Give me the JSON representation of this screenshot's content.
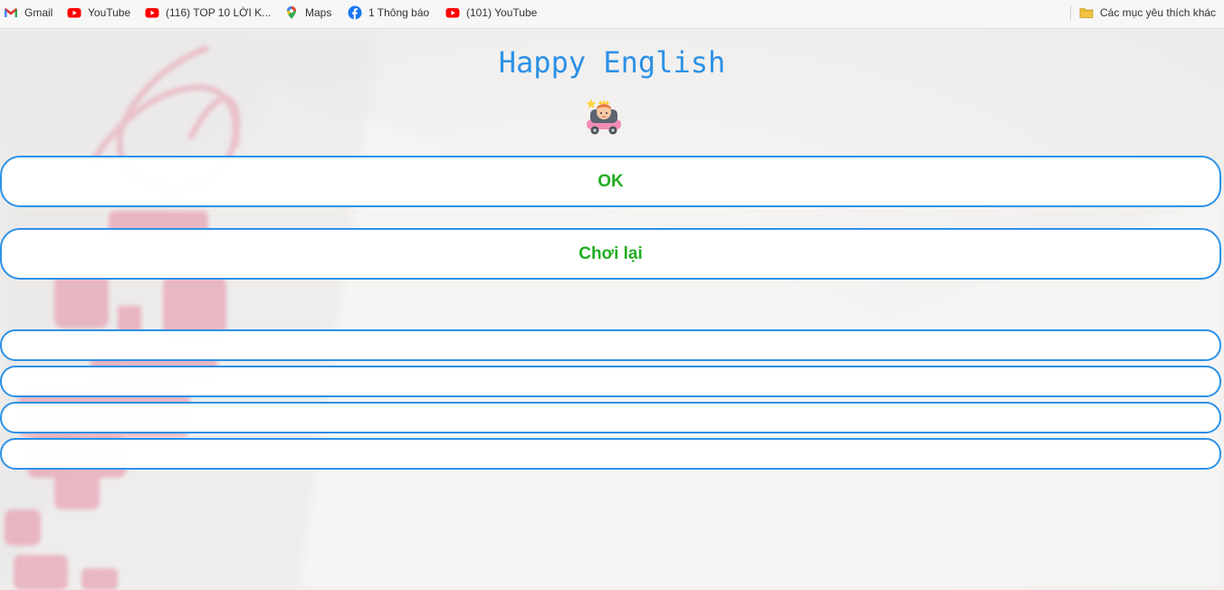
{
  "bookmarks": {
    "items": [
      {
        "label": "Gmail",
        "icon": "gmail-icon"
      },
      {
        "label": "YouTube",
        "icon": "youtube-icon"
      },
      {
        "label": "(116) TOP 10 LỜI K...",
        "icon": "youtube-icon"
      },
      {
        "label": "Maps",
        "icon": "maps-icon"
      },
      {
        "label": "1 Thông báo",
        "icon": "facebook-icon"
      },
      {
        "label": "(101) YouTube",
        "icon": "youtube-icon"
      }
    ],
    "other_folder": {
      "label": "Các mục yêu thích khác",
      "icon": "folder-icon"
    }
  },
  "page": {
    "title": "Happy English",
    "mascot_icon": "car-character-icon",
    "buttons": {
      "ok_label": "OK",
      "replay_label": "Chơi lại"
    },
    "answer_options": [
      "",
      "",
      "",
      ""
    ]
  },
  "colors": {
    "accent": "#2c91e6",
    "button_text": "#22ad22",
    "background": "#f3f2f1",
    "decor": "#e8a0b4"
  }
}
